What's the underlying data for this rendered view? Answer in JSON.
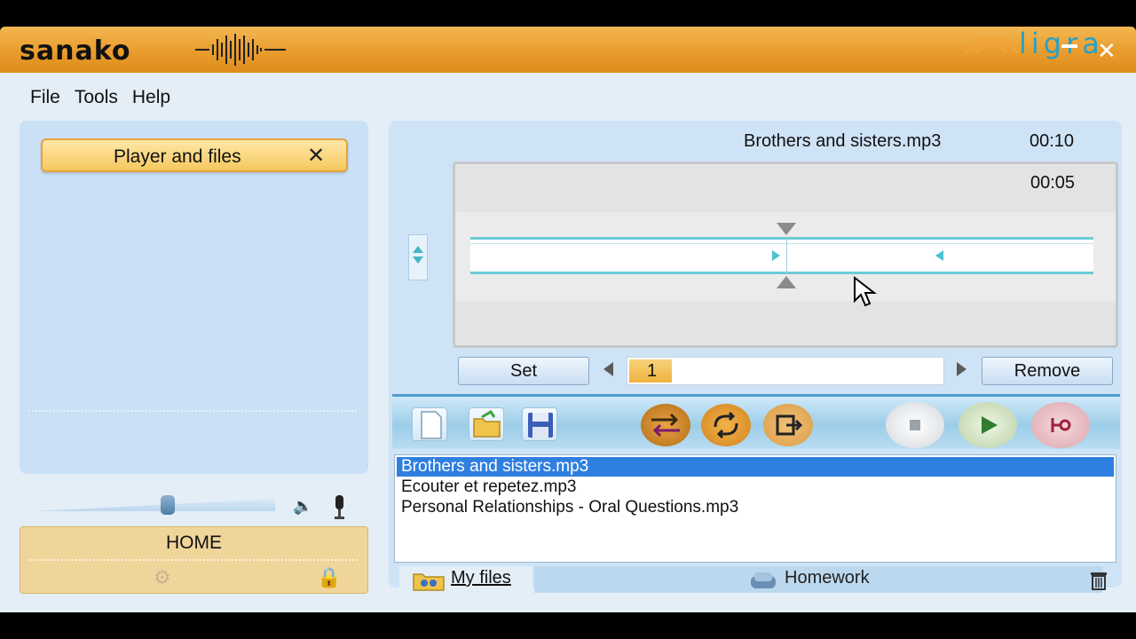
{
  "window": {
    "app_name": "sanako",
    "watermark": "ligra",
    "close_glyph": "✕"
  },
  "menu": [
    "File",
    "Tools",
    "Help"
  ],
  "left_panel": {
    "tab_label": "Player and files",
    "tab_close": "✕",
    "volume_level": 0.55,
    "home_label": "HOME"
  },
  "player": {
    "file_name": "Brothers and sisters.mp3",
    "total_time": "00:10",
    "position_time": "00:05",
    "position_fraction": 0.5,
    "segment_start_fraction": 0.497,
    "segment_end_fraction": 0.747,
    "set_label": "Set",
    "segment_number": "1",
    "remove_label": "Remove"
  },
  "toolbar": {
    "icons": [
      "new-file-icon",
      "open-folder-icon",
      "save-icon",
      "swap-icon",
      "repeat-icon",
      "export-icon",
      "stop-icon",
      "play-icon",
      "record-icon"
    ]
  },
  "files": [
    {
      "name": "Brothers and sisters.mp3",
      "selected": true
    },
    {
      "name": "Ecouter et repetez.mp3",
      "selected": false
    },
    {
      "name": "Personal Relationships - Oral Questions.mp3",
      "selected": false
    }
  ],
  "bottom_tabs": {
    "my_files": "My files",
    "homework": "Homework"
  },
  "colors": {
    "title_orange": "#e89a2a",
    "accent_teal": "#4ac2d1",
    "selection_blue": "#2f7fe0"
  }
}
